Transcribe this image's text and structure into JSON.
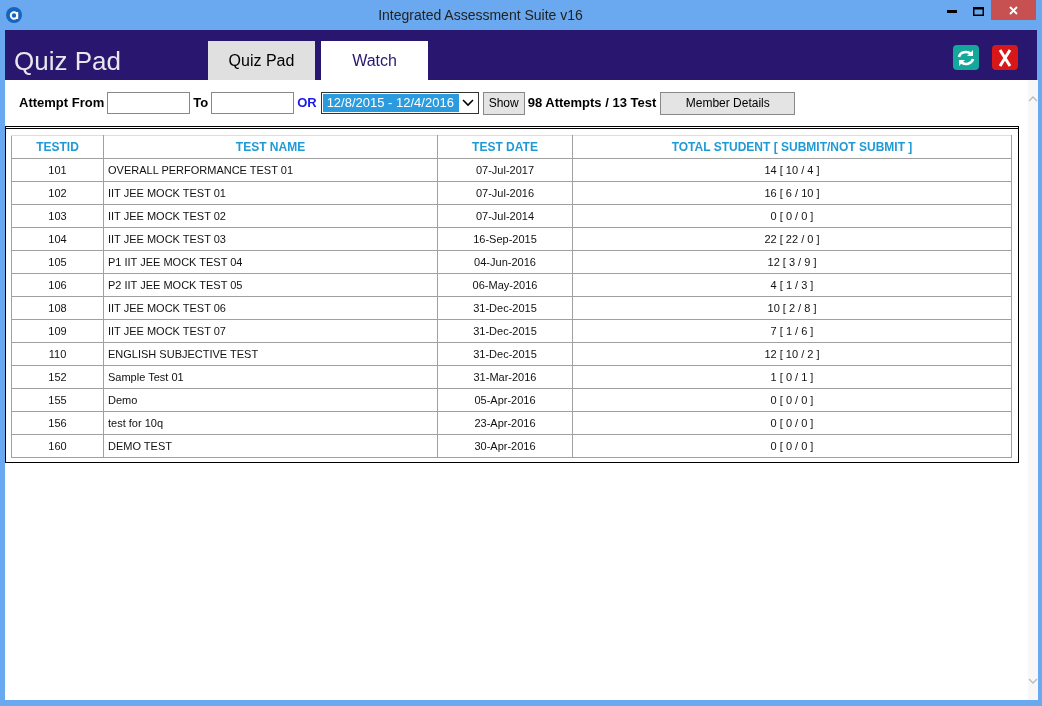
{
  "window": {
    "title": "Integrated Assessment Suite v16"
  },
  "header": {
    "app_name": "Quiz Pad"
  },
  "tabs": [
    {
      "label": "Quiz Pad",
      "selected": false
    },
    {
      "label": "Watch",
      "selected": true
    }
  ],
  "filter": {
    "attempt_from_label": "Attempt From",
    "to_label": "To",
    "or_label": "OR",
    "date_range": "12/8/2015 - 12/4/2016",
    "show_button": "Show",
    "summary": "98 Attempts / 13 Test",
    "member_details_button": "Member Details"
  },
  "table": {
    "columns": [
      "TESTID",
      "TEST NAME",
      "TEST DATE",
      "TOTAL STUDENT [ SUBMIT/NOT SUBMIT ]"
    ],
    "rows": [
      [
        "101",
        "OVERALL PERFORMANCE TEST 01",
        "07-Jul-2017",
        "14 [ 10 / 4 ]"
      ],
      [
        "102",
        "IIT JEE MOCK TEST 01",
        "07-Jul-2016",
        "16 [ 6 / 10 ]"
      ],
      [
        "103",
        "IIT JEE MOCK TEST 02",
        "07-Jul-2014",
        "0 [ 0 / 0 ]"
      ],
      [
        "104",
        "IIT JEE MOCK TEST 03",
        "16-Sep-2015",
        "22 [ 22 / 0 ]"
      ],
      [
        "105",
        "P1 IIT JEE MOCK TEST 04",
        "04-Jun-2016",
        "12 [ 3 / 9 ]"
      ],
      [
        "106",
        "P2 IIT JEE MOCK TEST 05",
        "06-May-2016",
        "4 [ 1 / 3 ]"
      ],
      [
        "108",
        "IIT JEE MOCK TEST 06",
        "31-Dec-2015",
        "10 [ 2 / 8 ]"
      ],
      [
        "109",
        "IIT JEE MOCK TEST 07",
        "31-Dec-2015",
        "7 [ 1 / 6 ]"
      ],
      [
        "110",
        "ENGLISH SUBJECTIVE TEST",
        "31-Dec-2015",
        "12 [ 10 / 2 ]"
      ],
      [
        "152",
        "Sample Test 01",
        "31-Mar-2016",
        "1 [ 0 / 1 ]"
      ],
      [
        "155",
        "Demo",
        "05-Apr-2016",
        "0 [ 0 / 0 ]"
      ],
      [
        "156",
        "test for 10q",
        "23-Apr-2016",
        "0 [ 0 / 0 ]"
      ],
      [
        "160",
        "DEMO TEST",
        "30-Apr-2016",
        "0 [ 0 / 0 ]"
      ]
    ]
  }
}
